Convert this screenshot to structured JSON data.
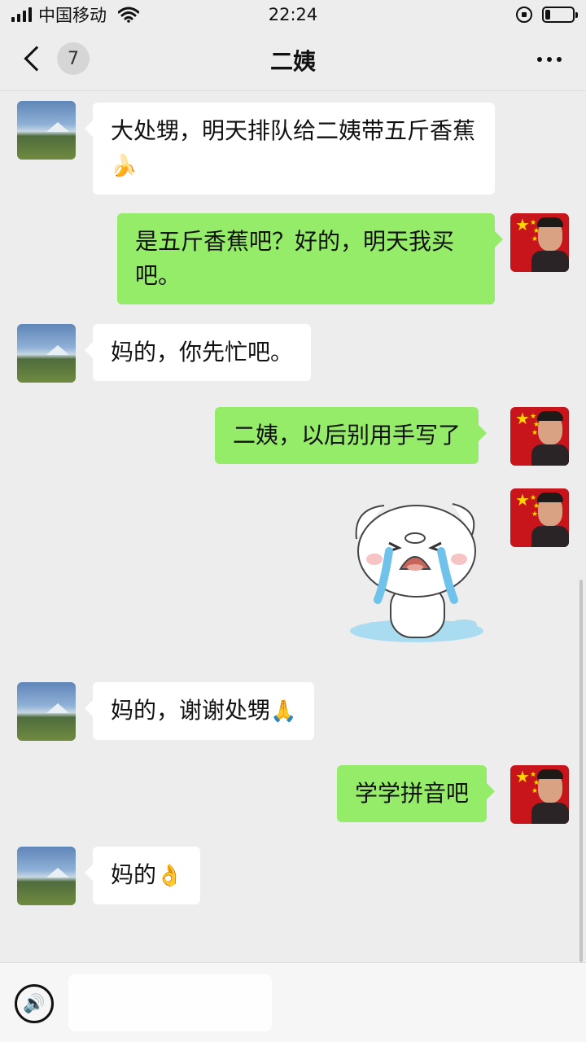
{
  "status_bar": {
    "carrier": "中国移动",
    "time": "22:24",
    "battery_level": 0.2
  },
  "nav": {
    "back_badge": "7",
    "title": "二姨"
  },
  "messages": [
    {
      "from": "aunt",
      "type": "text",
      "text": "大处甥，明天排队给二姨带五斤香蕉",
      "emoji": "🍌"
    },
    {
      "from": "me",
      "type": "text",
      "text": "是五斤香蕉吧？好的，明天我买吧。"
    },
    {
      "from": "aunt",
      "type": "text",
      "text": "妈的，你先忙吧。"
    },
    {
      "from": "me",
      "type": "text",
      "text": "二姨，以后别用手写了"
    },
    {
      "from": "me",
      "type": "sticker",
      "sticker": "crying-pig-sticker"
    },
    {
      "from": "aunt",
      "type": "text",
      "text": "妈的，谢谢处甥",
      "emoji": "🙏"
    },
    {
      "from": "me",
      "type": "text",
      "text": "学学拼音吧"
    },
    {
      "from": "aunt",
      "type": "text",
      "text": "妈的",
      "emoji": "👌"
    }
  ],
  "icons": {
    "back": "chevron-left-icon",
    "more": "more-dots-icon",
    "voice": "voice-icon",
    "wifi": "wifi-icon",
    "battery": "battery-icon"
  },
  "colors": {
    "outgoing_bubble": "#95ec69",
    "incoming_bubble": "#ffffff",
    "background": "#ededed"
  }
}
